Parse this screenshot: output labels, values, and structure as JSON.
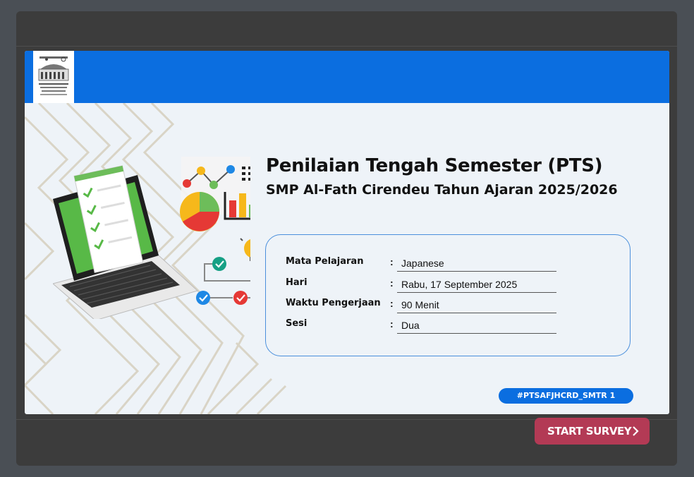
{
  "banner": {
    "title": "Penilaian Tengah Semester (PTS)",
    "subtitle": "SMP Al-Fath Cirendeu Tahun Ajaran 2025/2026",
    "info": {
      "mata_pelajaran_label": "Mata Pelajaran",
      "mata_pelajaran_value": "Japanese",
      "hari_label": "Hari",
      "hari_value": "Rabu, 17 September 2025",
      "waktu_label": "Waktu Pengerjaan",
      "waktu_value": "90 Menit",
      "sesi_label": "Sesi",
      "sesi_value": "Dua",
      "colon": ":"
    },
    "hashtag": "#PTSAFJHCRD_SMTR 1",
    "colors": {
      "header": "#0b6ee0",
      "background": "#eef3f8",
      "card_border": "#4a8fdc"
    }
  },
  "footer": {
    "start_label": "START SURVEY",
    "start_icon": "chevron-right-icon",
    "button_color": "#b33a55"
  }
}
